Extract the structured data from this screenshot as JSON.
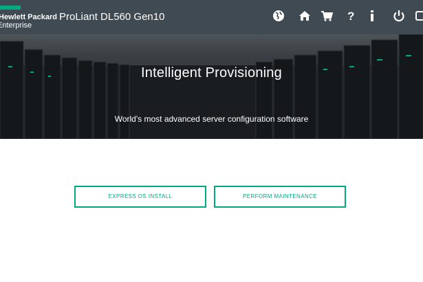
{
  "header": {
    "logo_line1": "Hewlett Packard",
    "logo_line2": "Enterprise",
    "product_title": "ProLiant DL560 Gen10",
    "icons": [
      "globe-icon",
      "home-icon",
      "cart-icon",
      "help-icon",
      "info-icon",
      "power-icon",
      "exit-icon"
    ]
  },
  "hero": {
    "title": "Intelligent Provisioning",
    "subtitle": "World's most advanced server configuration software"
  },
  "actions": {
    "express_os_install": "EXPRESS OS INSTALL",
    "perform_maintenance": "PERFORM MAINTENANCE"
  },
  "colors": {
    "accent": "#01a982",
    "header_bg": "#3f4a52"
  }
}
